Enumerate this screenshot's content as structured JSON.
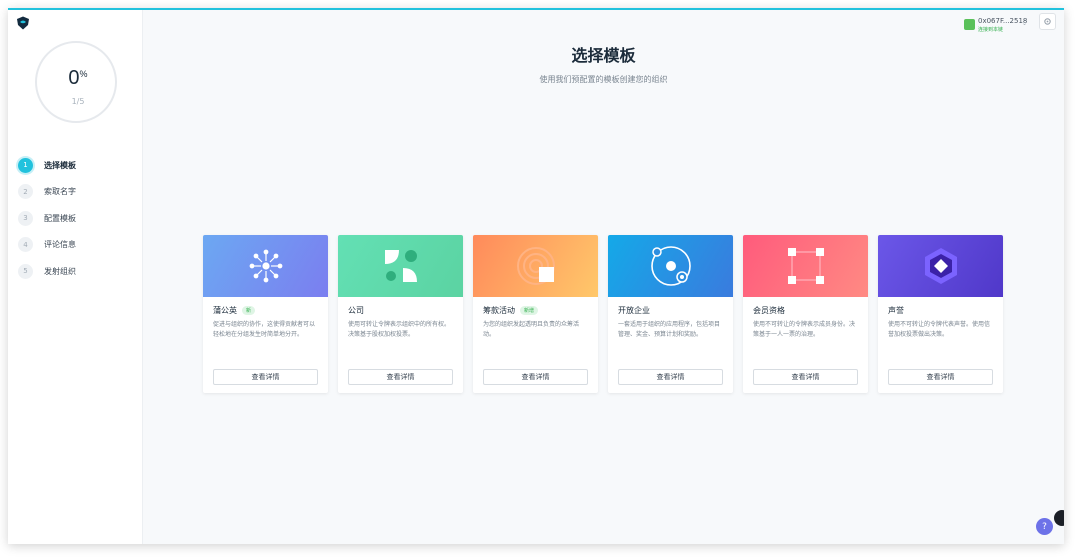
{
  "progress": {
    "percent": "0",
    "percent_sign": "%",
    "fraction": "1/5"
  },
  "steps": [
    {
      "num": "1",
      "label": "选择模板",
      "active": true
    },
    {
      "num": "2",
      "label": "索取名字"
    },
    {
      "num": "3",
      "label": "配置模板"
    },
    {
      "num": "4",
      "label": "评论信息"
    },
    {
      "num": "5",
      "label": "发射组织"
    }
  ],
  "header": {
    "address": "0x067F...2518",
    "network": "连接到本链"
  },
  "main": {
    "title": "选择模板",
    "subtitle": "使用我们预配置的模板创建您的组织"
  },
  "cards": [
    {
      "title": "蒲公英",
      "badge": "新",
      "desc": "促进与组织的协作，这使得贡献者可以轻松地在分组发生时简单地分开。",
      "button": "查看详情",
      "gradient": [
        "#6ca8f2",
        "#7b7ef0"
      ],
      "icon": "dandelion-icon"
    },
    {
      "title": "公司",
      "badge": "",
      "desc": "使用可转让令牌表示组织中的所有权。决策基于股权加权投票。",
      "button": "查看详情",
      "gradient": [
        "#63e0b4",
        "#5bd3a2"
      ],
      "icon": "leaf-icon"
    },
    {
      "title": "筹款活动",
      "badge": "新增",
      "desc": "为您的组织发起透明且负责的众筹活动。",
      "button": "查看详情",
      "gradient": [
        "#ff8a5b",
        "#ffc86a"
      ],
      "icon": "signal-icon"
    },
    {
      "title": "开放企业",
      "badge": "",
      "desc": "一套适用于组织的应用程序，包括项目管理、奖金、预算计划和奖励。",
      "button": "查看详情",
      "gradient": [
        "#14a9e8",
        "#3a7bde"
      ],
      "icon": "orbit-icon"
    },
    {
      "title": "会员资格",
      "badge": "",
      "desc": "使用不可转让的令牌表示成员身份。决策基于一人一票的治理。",
      "button": "查看详情",
      "gradient": [
        "#ff5b7c",
        "#ff8a83"
      ],
      "icon": "square-nodes-icon"
    },
    {
      "title": "声誉",
      "badge": "",
      "desc": "使用不可转让的令牌代表声誉。使用信誉加权投票做出决策。",
      "button": "查看详情",
      "gradient": [
        "#6b57e8",
        "#5038c9"
      ],
      "icon": "hexagon-icon"
    }
  ],
  "help": {
    "label": "?"
  },
  "colors": {
    "accent": "#21c2dd",
    "badge_green": "#35b04f"
  }
}
